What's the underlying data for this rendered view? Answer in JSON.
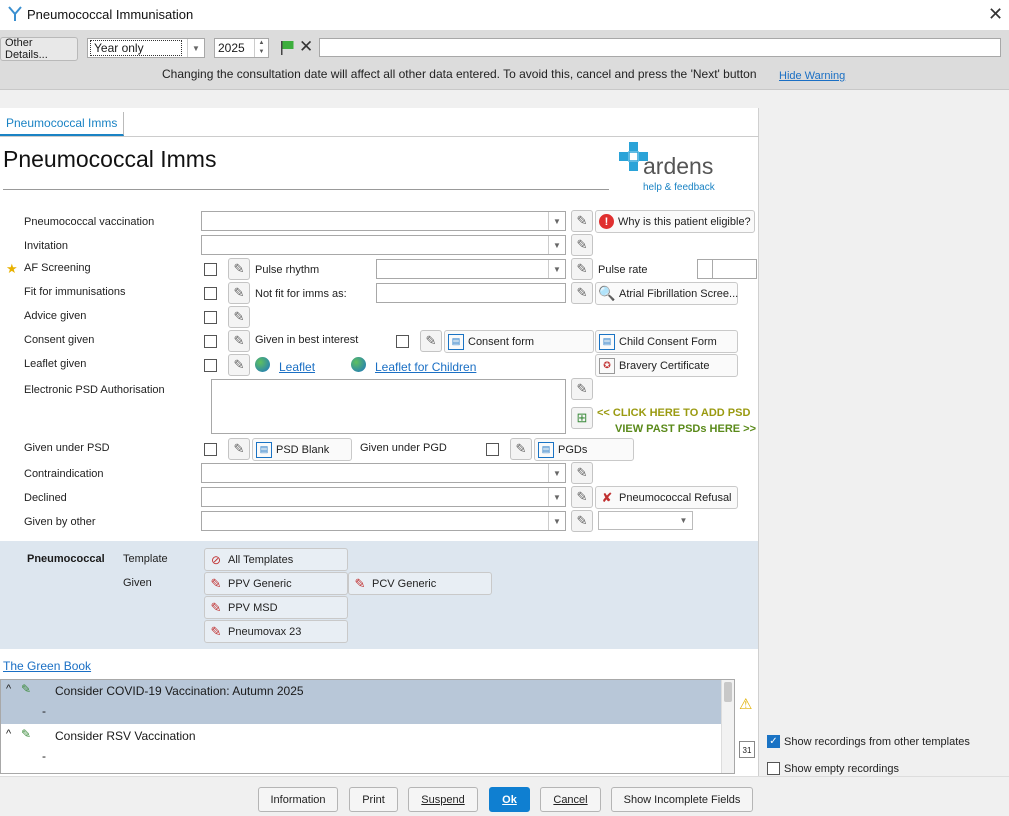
{
  "window": {
    "title": "Pneumococcal Immunisation"
  },
  "datebar": {
    "other_details": "Other Details...",
    "date_mode": "Year only",
    "year": "2025",
    "warning": "Changing the consultation date will affect all other data entered. To avoid this, cancel and press the 'Next' button",
    "hide_warning": "Hide Warning"
  },
  "tabs": [
    "Pneumococcal Imms"
  ],
  "page_title": "Pneumococcal Imms",
  "logo": {
    "brand": "ardens",
    "tagline": "help & feedback"
  },
  "fields": {
    "pneumo_vacc": "Pneumococcal vaccination",
    "invitation": "Invitation",
    "af_screening": "AF Screening",
    "pulse_rhythm": "Pulse rhythm",
    "pulse_rate": "Pulse rate",
    "fit_imms": "Fit for immunisations",
    "not_fit_as": "Not fit for imms as:",
    "advice_given": "Advice given",
    "consent_given": "Consent given",
    "best_interest": "Given in best interest",
    "leaflet_given": "Leaflet given",
    "eps_auth": "Electronic PSD Authorisation",
    "given_psd": "Given under PSD",
    "given_pgd": "Given under PGD",
    "contraindication": "Contraindication",
    "declined": "Declined",
    "given_other": "Given by other"
  },
  "buttons": {
    "why_eligible": "Why is this patient eligible?",
    "af_screen": "Atrial Fibrillation Scree...",
    "consent_form": "Consent form",
    "child_consent": "Child Consent Form",
    "bravery": "Bravery Certificate",
    "psd_blank": "PSD Blank",
    "pgds": "PGDs",
    "pneumo_refusal": "Pneumococcal Refusal"
  },
  "links": {
    "leaflet": "Leaflet",
    "leaflet_children": "Leaflet for Children",
    "add_psd": "<< CLICK HERE TO ADD PSD",
    "view_psd": "VIEW PAST PSDs HERE >>",
    "green_book": "The Green Book"
  },
  "templates": {
    "group": "Pneumococcal",
    "template_label": "Template",
    "given_label": "Given",
    "all_templates": "All Templates",
    "ppv_generic": "PPV Generic",
    "pcv_generic": "PCV Generic",
    "ppv_msd": "PPV MSD",
    "pneumovax": "Pneumovax 23"
  },
  "recordings": [
    {
      "title": "Consider COVID-19 Vaccination: Autumn 2025",
      "value": "-"
    },
    {
      "title": "Consider RSV Vaccination",
      "value": "-"
    }
  ],
  "options": {
    "show_other": "Show recordings from other templates",
    "show_other_checked": true,
    "show_empty": "Show empty recordings",
    "show_empty_checked": false
  },
  "footer": {
    "information": "Information",
    "print": "Print",
    "suspend": "Suspend",
    "ok": "Ok",
    "cancel": "Cancel",
    "show_incomplete": "Show Incomplete Fields"
  },
  "colors": {
    "accent": "#0f7fd1",
    "ardens_blue": "#1a83c4",
    "panel": "#dde6ef",
    "selected_row": "#b8c7d8"
  }
}
